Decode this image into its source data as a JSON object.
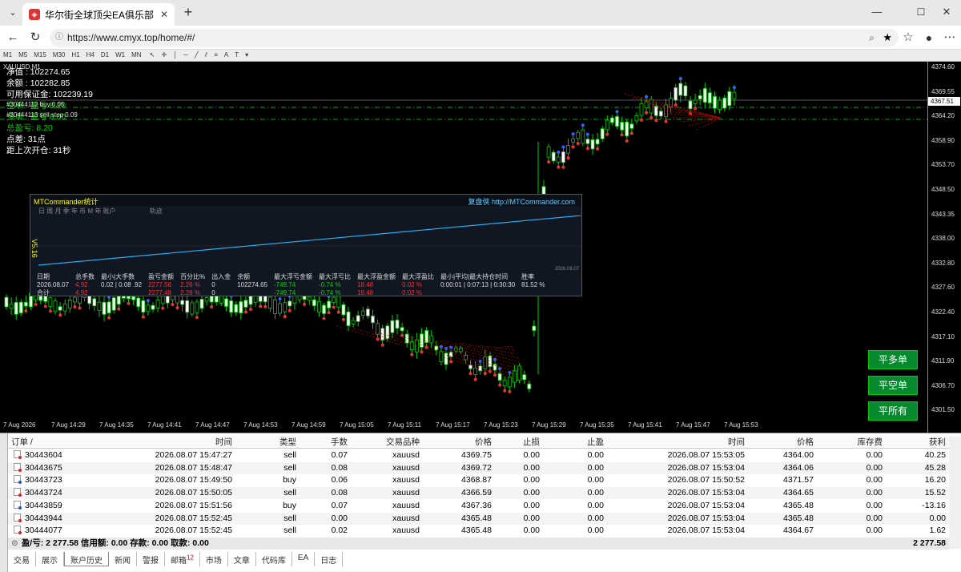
{
  "browser": {
    "tab_title": "华尔街全球顶尖EA俱乐部",
    "url": "https://www.cmyx.top/home/#/"
  },
  "mt_toolbar": {
    "timeframes": [
      "M1",
      "M5",
      "M15",
      "M30",
      "H1",
      "H4",
      "D1",
      "W1",
      "MN"
    ],
    "symbol_label": "XAUUSD,M1"
  },
  "chart": {
    "info": {
      "line1": "净值 : 102274.65",
      "line2": "余额 : 102282.85",
      "line3": "可用保证金: 102239.19",
      "line4": "空单 : 盈亏 8.20",
      "line5": "多单 : 盈亏 0.00",
      "line6": "总盈亏: 8.20",
      "line7": "点差: 31点",
      "line8": "距上次开仓: 31秒"
    },
    "orders": [
      "#30444112 buy 0.05",
      "#30444113 sell stop 0.09"
    ],
    "price_ticks": [
      "4374.60",
      "4369.55",
      "4364.20",
      "4358.90",
      "4353.70",
      "4348.50",
      "4343.35",
      "4338.00",
      "4332.80",
      "4327.60",
      "4322.40",
      "4317.10",
      "4311.90",
      "4306.70",
      "4301.50"
    ],
    "current_price": "4367.51",
    "time_ticks": [
      "7 Aug 2026",
      "7 Aug 14:29",
      "7 Aug 14:35",
      "7 Aug 14:41",
      "7 Aug 14:47",
      "7 Aug 14:53",
      "7 Aug 14:59",
      "7 Aug 15:05",
      "7 Aug 15:11",
      "7 Aug 15:17",
      "7 Aug 15:23",
      "7 Aug 15:29",
      "7 Aug 15:35",
      "7 Aug 15:41",
      "7 Aug 15:47",
      "7 Aug 15:53"
    ],
    "buttons": {
      "close_long": "平多单",
      "close_short": "平空单",
      "close_all": "平所有"
    }
  },
  "mtc_panel": {
    "title": "MTCommander统计",
    "link": "复盘侠 http://MTCommander.com",
    "tabs": [
      "日",
      "周",
      "月",
      "季",
      "年",
      "币",
      "M",
      "年",
      "账户",
      "轨迹"
    ],
    "version": "V5.16",
    "date_label": "2026.08.07",
    "headers": [
      "日期",
      "总手数",
      "最小|大手数",
      "盈亏金额",
      "百分比%",
      "出入金",
      "余额",
      "最大浮亏金额",
      "最大浮亏比",
      "最大浮盈金额",
      "最大浮盈比",
      "最小|平均|最大持仓时间",
      "胜率"
    ],
    "rows": [
      [
        "2026.08.07",
        "4.92",
        "0.02 | 0.08 .92",
        "2277.56",
        "2.26 %",
        "0",
        "102274.65",
        "-749.74",
        "-0.74 %",
        "18.48",
        "0.02 %",
        "0:00:01 | 0:07:13 | 0:30:30",
        "81.52 %"
      ],
      [
        "合计",
        "4.92",
        "",
        "2277.48",
        "2.28 %",
        "0",
        "",
        "-749.74",
        "-0.74 %",
        "18.48",
        "0.02 %",
        "",
        ""
      ]
    ]
  },
  "terminal": {
    "columns": [
      "订单 /",
      "时间",
      "类型",
      "手数",
      "交易品种",
      "价格",
      "止损",
      "止盈",
      "时间",
      "价格",
      "库存费",
      "获利"
    ],
    "rows": [
      {
        "order": "30443604",
        "open_time": "2026.08.07 15:47:27",
        "type": "sell",
        "lots": "0.07",
        "symbol": "xauusd",
        "open_price": "4369.75",
        "sl": "0.00",
        "tp": "0.00",
        "close_time": "2026.08.07 15:53:05",
        "close_price": "4364.00",
        "swap": "0.00",
        "profit": "40.25"
      },
      {
        "order": "30443675",
        "open_time": "2026.08.07 15:48:47",
        "type": "sell",
        "lots": "0.08",
        "symbol": "xauusd",
        "open_price": "4369.72",
        "sl": "0.00",
        "tp": "0.00",
        "close_time": "2026.08.07 15:53:04",
        "close_price": "4364.06",
        "swap": "0.00",
        "profit": "45.28"
      },
      {
        "order": "30443723",
        "open_time": "2026.08.07 15:49:50",
        "type": "buy",
        "lots": "0.06",
        "symbol": "xauusd",
        "open_price": "4368.87",
        "sl": "0.00",
        "tp": "0.00",
        "close_time": "2026.08.07 15:50:52",
        "close_price": "4371.57",
        "swap": "0.00",
        "profit": "16.20"
      },
      {
        "order": "30443724",
        "open_time": "2026.08.07 15:50:05",
        "type": "sell",
        "lots": "0.08",
        "symbol": "xauusd",
        "open_price": "4366.59",
        "sl": "0.00",
        "tp": "0.00",
        "close_time": "2026.08.07 15:53:04",
        "close_price": "4364.65",
        "swap": "0.00",
        "profit": "15.52"
      },
      {
        "order": "30443859",
        "open_time": "2026.08.07 15:51:56",
        "type": "buy",
        "lots": "0.07",
        "symbol": "xauusd",
        "open_price": "4367.36",
        "sl": "0.00",
        "tp": "0.00",
        "close_time": "2026.08.07 15:53:04",
        "close_price": "4365.48",
        "swap": "0.00",
        "profit": "-13.16"
      },
      {
        "order": "30443944",
        "open_time": "2026.08.07 15:52:45",
        "type": "sell",
        "lots": "0.00",
        "symbol": "xauusd",
        "open_price": "4365.48",
        "sl": "0.00",
        "tp": "0.00",
        "close_time": "2026.08.07 15:53:04",
        "close_price": "4365.48",
        "swap": "0.00",
        "profit": "0.00"
      },
      {
        "order": "30444077",
        "open_time": "2026.08.07 15:52:45",
        "type": "sell",
        "lots": "0.02",
        "symbol": "xauusd",
        "open_price": "4365.48",
        "sl": "0.00",
        "tp": "0.00",
        "close_time": "2026.08.07 15:53:04",
        "close_price": "4364.67",
        "swap": "0.00",
        "profit": "1.62"
      }
    ],
    "summary": "盈/亏: 2 277.58  信用额: 0.00  存款: 0.00  取款: 0.00",
    "summary_total": "2 277.58",
    "bottom_tabs": [
      "交易",
      "展示",
      "账户历史",
      "新闻",
      "警报",
      "邮箱",
      "市场",
      "文章",
      "代码库",
      "EA",
      "日志"
    ],
    "mail_badge": "12",
    "active_tab": "账户历史"
  }
}
